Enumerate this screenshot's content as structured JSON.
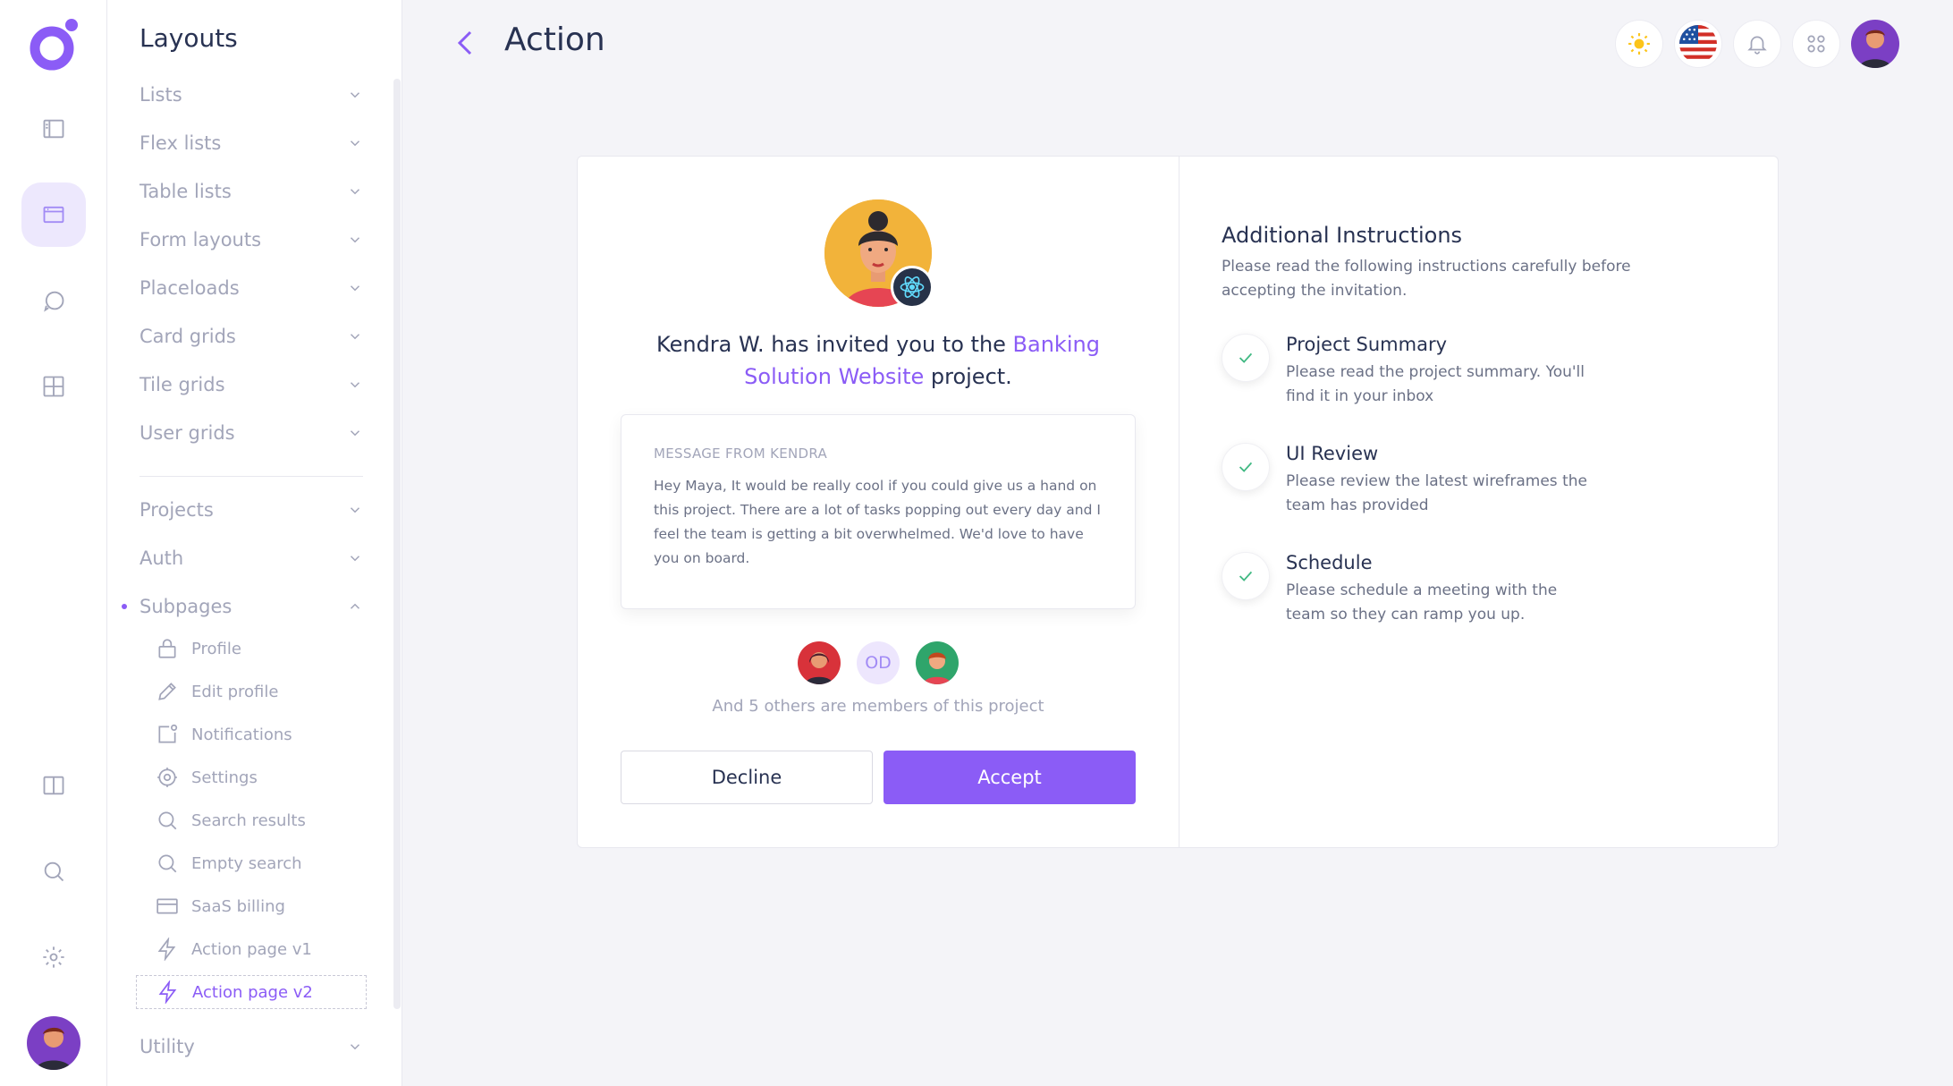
{
  "sidebar": {
    "title": "Layouts",
    "menu": [
      {
        "label": "Lists"
      },
      {
        "label": "Flex lists"
      },
      {
        "label": "Table lists"
      },
      {
        "label": "Form layouts"
      },
      {
        "label": "Placeloads"
      },
      {
        "label": "Card grids"
      },
      {
        "label": "Tile grids"
      },
      {
        "label": "User grids"
      },
      {
        "label": "Projects"
      },
      {
        "label": "Auth"
      },
      {
        "label": "Subpages"
      },
      {
        "label": "Utility"
      }
    ],
    "subpages": [
      {
        "label": "Profile",
        "icon": "lock-icon"
      },
      {
        "label": "Edit profile",
        "icon": "pencil-icon"
      },
      {
        "label": "Notifications",
        "icon": "notification-square-icon"
      },
      {
        "label": "Settings",
        "icon": "gear-icon"
      },
      {
        "label": "Search results",
        "icon": "search-icon"
      },
      {
        "label": "Empty search",
        "icon": "search-icon"
      },
      {
        "label": "SaaS billing",
        "icon": "credit-card-icon"
      },
      {
        "label": "Action page v1",
        "icon": "lightning-icon"
      },
      {
        "label": "Action page v2",
        "icon": "lightning-icon"
      }
    ]
  },
  "header": {
    "title": "Action"
  },
  "invite": {
    "prefix": "Kendra W. has invited you to the ",
    "project_link": "Banking Solution Website",
    "suffix": " project.",
    "message_label": "MESSAGE FROM KENDRA",
    "message_body": "Hey Maya, It would be really cool if you could give us a hand on this project. There are a lot of tasks popping out every day and I feel the team is getting a bit overwhelmed. We'd love to have you on board.",
    "member_initials": "OD",
    "members_text": "And 5 others are members of this project",
    "decline_label": "Decline",
    "accept_label": "Accept"
  },
  "instructions": {
    "title": "Additional Instructions",
    "subtitle": "Please read the following instructions carefully before accepting the invitation.",
    "steps": [
      {
        "title": "Project Summary",
        "desc": "Please read the project summary. You'll find it in your inbox"
      },
      {
        "title": "UI Review",
        "desc": "Please review the latest wireframes the team has provided"
      },
      {
        "title": "Schedule",
        "desc": "Please schedule a meeting with the team so they can ramp you up."
      }
    ]
  },
  "colors": {
    "accent": "#8b5cf6",
    "success": "#41b983"
  }
}
